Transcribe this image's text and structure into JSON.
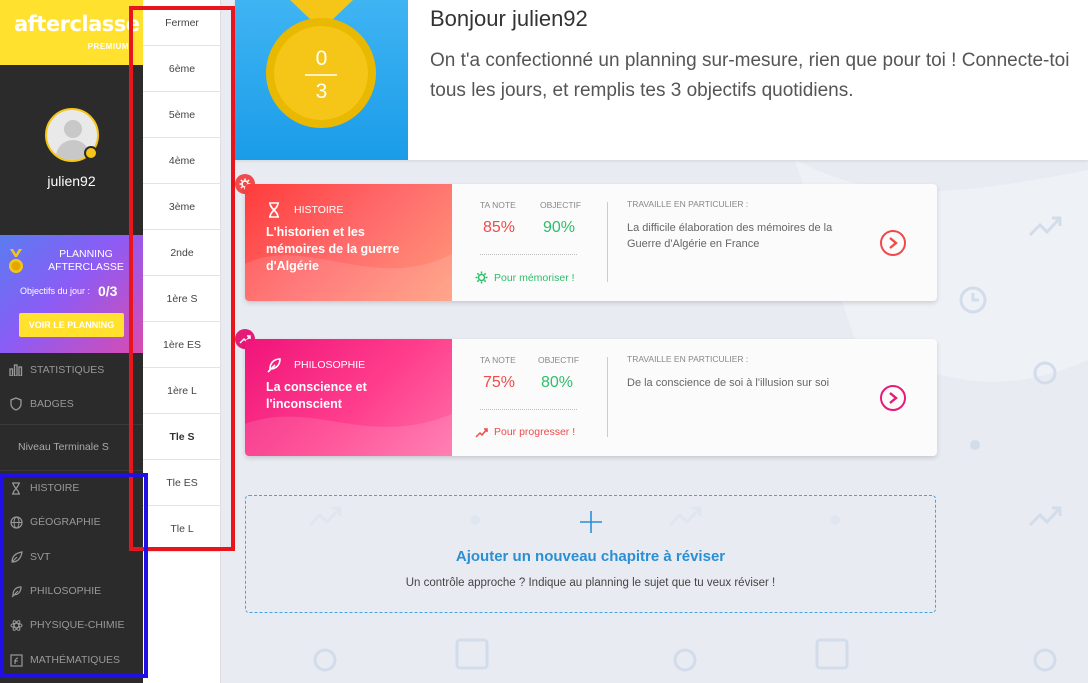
{
  "brand": {
    "logo_text": "afterclasse",
    "tier": "PREMIUM"
  },
  "user": {
    "username": "julien92"
  },
  "planning_widget": {
    "title": "PLANNING AFTERCLASSE",
    "objectives_label": "Objectifs du jour :",
    "objectives_value": "0/3",
    "button_label": "VOIR LE PLANNING"
  },
  "nav": {
    "statistiques": "STATISTIQUES",
    "badges": "BADGES",
    "niveau": "Niveau Terminale S",
    "subjects": [
      "HISTOIRE",
      "GÉOGRAPHIE",
      "SVT",
      "PHILOSOPHIE",
      "PHYSIQUE-CHIMIE",
      "MATHÉMATIQUES"
    ]
  },
  "grades": [
    "Fermer",
    "6ème",
    "5ème",
    "4ème",
    "3ème",
    "2nde",
    "1ère S",
    "1ère ES",
    "1ère L",
    "Tle S",
    "Tle ES",
    "Tle L"
  ],
  "header": {
    "medal_top": "0",
    "medal_bottom": "3",
    "greeting": "Bonjour julien92",
    "intro": "On t'a confectionné un planning sur-mesure, rien que pour toi ! Connecte-toi tous les jours, et remplis tes 3 objectifs quotidiens."
  },
  "cards": [
    {
      "subject": "HISTOIRE",
      "chapter": "L'historien et les mémoires de la guerre d'Algérie",
      "note_label": "TA NOTE",
      "note_value": "85%",
      "objective_label": "OBJECTIF",
      "objective_value": "90%",
      "tip": "Pour mémoriser !",
      "work_label": "TRAVAILLE EN PARTICULIER :",
      "work_text": "La difficile élaboration des mémoires de la Guerre d'Algérie en France",
      "colors": {
        "grad_start": "#ff3b3b",
        "grad_end": "#ff8a6b",
        "note": "#f04a4a",
        "objective": "#2ebd6b",
        "tip": "#2ebd6b",
        "accent": "#f04a4a"
      }
    },
    {
      "subject": "PHILOSOPHIE",
      "chapter": "La conscience et l'inconscient",
      "note_label": "TA NOTE",
      "note_value": "75%",
      "objective_label": "OBJECTIF",
      "objective_value": "80%",
      "tip": "Pour progresser !",
      "work_label": "TRAVAILLE EN PARTICULIER :",
      "work_text": "De la conscience de soi à l'illusion sur soi",
      "colors": {
        "grad_start": "#f0147a",
        "grad_end": "#ff5aa0",
        "note": "#f04a4a",
        "objective": "#2ebd6b",
        "tip": "#f04a4a",
        "accent": "#e61b78"
      }
    }
  ],
  "add_chapter": {
    "title": "Ajouter un nouveau chapitre à réviser",
    "subtitle": "Un contrôle approche ? Indique au planning le sujet que tu veux réviser !"
  },
  "colors": {
    "sidebar": "#2b2b2b",
    "logo_bg": "#ffe12e",
    "accent_blue": "#2a8fd4",
    "highlight_red": "#e8161c",
    "highlight_blue": "#2010e6"
  }
}
